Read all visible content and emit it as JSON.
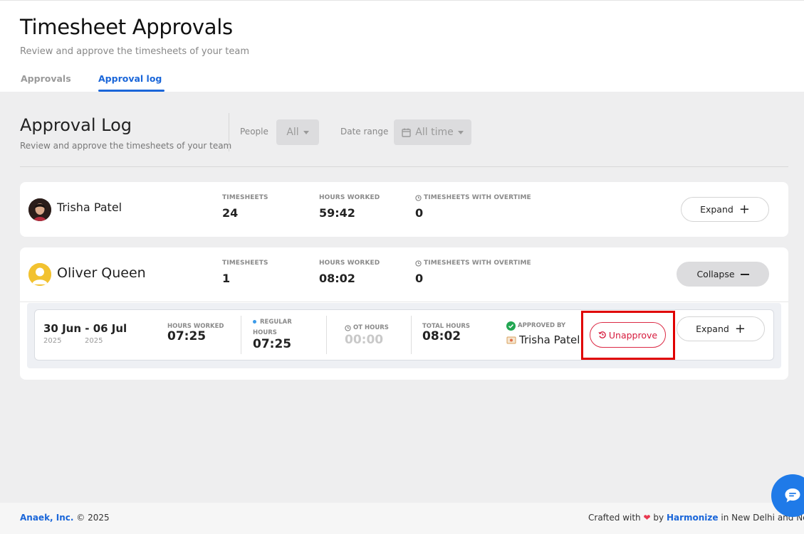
{
  "header": {
    "title": "Timesheet Approvals",
    "subtitle": "Review and approve the timesheets of your team",
    "tabs": [
      {
        "label": "Approvals"
      },
      {
        "label": "Approval log"
      }
    ]
  },
  "log": {
    "title": "Approval Log",
    "subtitle": "Review and approve the timesheets of your team",
    "filters": {
      "people_label": "People",
      "people_value": "All",
      "date_label": "Date range",
      "date_value": "All time"
    }
  },
  "columns": {
    "timesheets": "TIMESHEETS",
    "hours_worked": "HOURS WORKED",
    "overtime": "TIMESHEETS WITH OVERTIME"
  },
  "people": [
    {
      "name": "Trisha Patel",
      "timesheets": "24",
      "hours_worked": "59:42",
      "overtime": "0",
      "action_label": "Expand"
    },
    {
      "name": "Oliver Queen",
      "timesheets": "1",
      "hours_worked": "08:02",
      "overtime": "0",
      "action_label": "Collapse"
    }
  ],
  "timesheet": {
    "range": "30 Jun - 06 Jul",
    "start_year": "2025",
    "end_year": "2025",
    "hours_worked_label": "HOURS WORKED",
    "hours_worked": "07:25",
    "regular_label_1": "REGULAR",
    "regular_label_2": "HOURS",
    "regular_hours": "07:25",
    "ot_label": "OT HOURS",
    "ot_hours": "00:00",
    "total_label": "TOTAL HOURS",
    "total_hours": "08:02",
    "approved_label": "APPROVED BY",
    "approved_by": "Trisha Patel",
    "unapprove_label": "Unapprove",
    "expand_label": "Expand"
  },
  "footer": {
    "company": "Anaek, Inc.",
    "copyright": "© 2025",
    "crafted_prefix": "Crafted with",
    "crafted_by": "by",
    "brand": "Harmonize",
    "location": "in New Delhi and New York"
  },
  "colors": {
    "accent": "#1a66d9",
    "danger": "#d61a3c",
    "success": "#22a652",
    "chat": "#1f7ae8"
  }
}
